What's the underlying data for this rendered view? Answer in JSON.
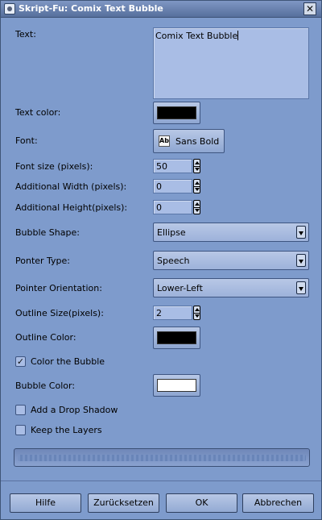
{
  "window": {
    "title": "Skript-Fu: Comix Text Bubble",
    "close_glyph": "✕"
  },
  "form": {
    "text_label": "Text:",
    "text_value": "Comix Text Bubble",
    "text_color_label": "Text color:",
    "text_color": "#000000",
    "font_label": "Font:",
    "font_value": "Sans Bold",
    "font_icon_glyph": "Ab",
    "font_size_label": "Font size (pixels):",
    "font_size_value": "50",
    "add_width_label": "Additional Width (pixels):",
    "add_width_value": "0",
    "add_height_label": "Additional Height(pixels):",
    "add_height_value": "0",
    "bubble_shape_label": "Bubble Shape:",
    "bubble_shape_value": "Ellipse",
    "pointer_type_label": "Ponter Type:",
    "pointer_type_value": "Speech",
    "pointer_orientation_label": "Pointer Orientation:",
    "pointer_orientation_value": "Lower-Left",
    "outline_size_label": "Outline Size(pixels):",
    "outline_size_value": "2",
    "outline_color_label": "Outline Color:",
    "outline_color": "#000000",
    "color_bubble_label": "Color the Bubble",
    "color_bubble_checked": "✓",
    "bubble_color_label": "Bubble Color:",
    "bubble_color": "#ffffff",
    "drop_shadow_label": "Add a Drop Shadow",
    "keep_layers_label": "Keep the Layers"
  },
  "progress": {
    "value": 0
  },
  "buttons": {
    "help": "Hilfe",
    "reset": "Zurücksetzen",
    "ok": "OK",
    "cancel": "Abbrechen"
  }
}
